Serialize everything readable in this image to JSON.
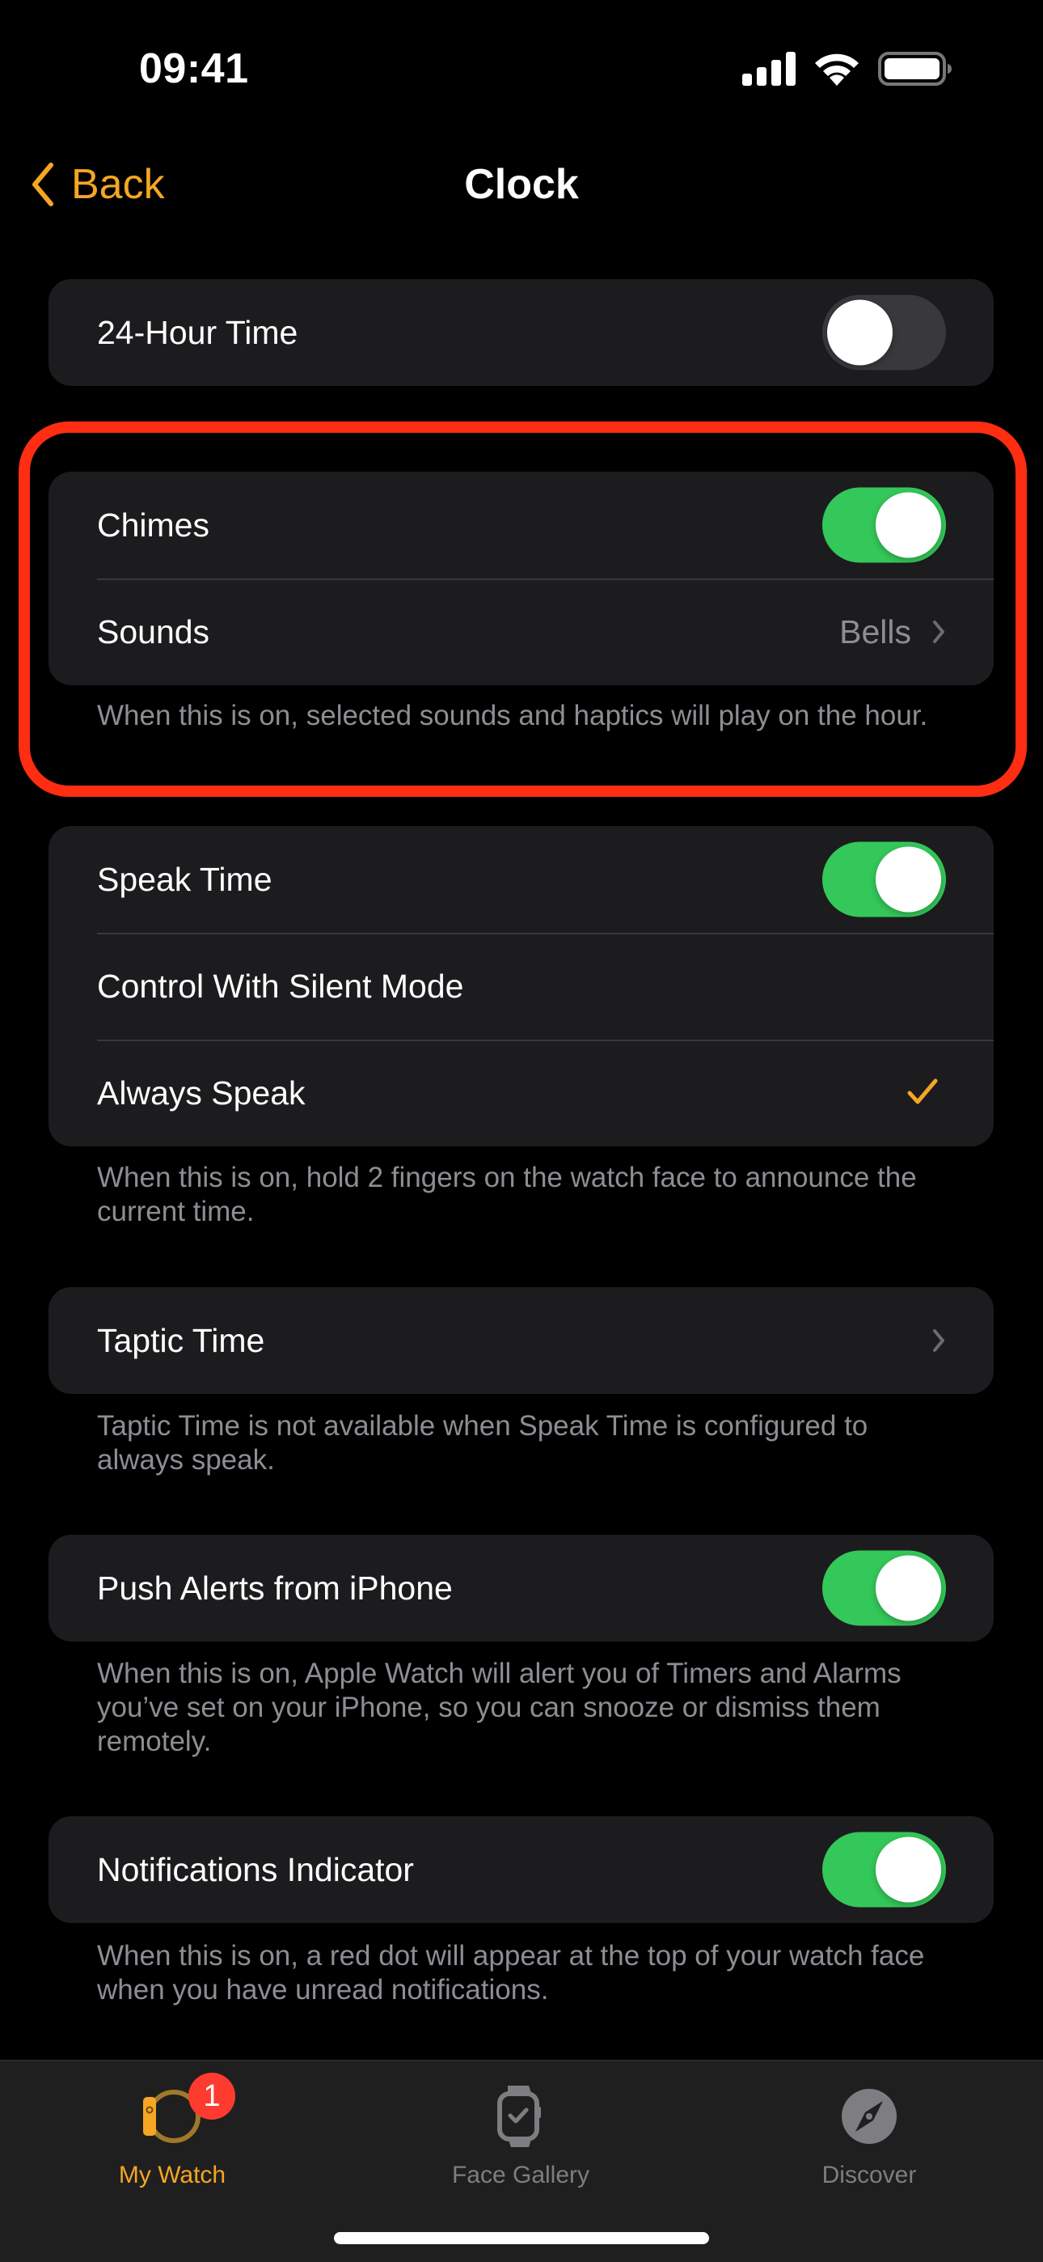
{
  "status_bar": {
    "time": "09:41",
    "icons": [
      "cellular-signal-icon",
      "wifi-icon",
      "battery-icon"
    ]
  },
  "nav": {
    "back_label": "Back",
    "title": "Clock"
  },
  "colors": {
    "accent": "#f5a623",
    "toggle_on": "#34c759",
    "toggle_off": "#39393d",
    "card_bg": "#1c1c1e",
    "highlight": "#ff2d12",
    "badge": "#ff3b30",
    "secondary_text": "#8d8d93"
  },
  "sections": {
    "hour24": {
      "label": "24-Hour Time",
      "on": false
    },
    "chimes": {
      "rows": [
        {
          "label": "Chimes",
          "type": "toggle",
          "on": true
        },
        {
          "label": "Sounds",
          "type": "disclosure",
          "value": "Bells"
        }
      ],
      "footer": "When this is on, selected sounds and haptics will play on the hour."
    },
    "speak_time": {
      "rows": [
        {
          "label": "Speak Time",
          "type": "toggle",
          "on": true
        },
        {
          "label": "Control With Silent Mode",
          "type": "option",
          "selected": false
        },
        {
          "label": "Always Speak",
          "type": "option",
          "selected": true
        }
      ],
      "footer": "When this is on, hold 2 fingers on the watch face to announce the current time."
    },
    "taptic_time": {
      "label": "Taptic Time",
      "type": "disclosure",
      "footer": "Taptic Time is not available when Speak Time is configured to always speak."
    },
    "push_alerts": {
      "label": "Push Alerts from iPhone",
      "on": true,
      "footer": "When this is on, Apple Watch will alert you of Timers and Alarms you’ve set on your iPhone, so you can snooze or dismiss them remotely."
    },
    "notifications_indicator": {
      "label": "Notifications Indicator",
      "on": true,
      "footer": "When this is on, a red dot will appear at the top of your watch face when you have unread notifications."
    }
  },
  "tabbar": {
    "tabs": [
      {
        "label": "My Watch",
        "icon": "my-watch-icon",
        "active": true,
        "badge": "1"
      },
      {
        "label": "Face Gallery",
        "icon": "face-gallery-icon",
        "active": false
      },
      {
        "label": "Discover",
        "icon": "compass-icon",
        "active": false
      }
    ]
  }
}
